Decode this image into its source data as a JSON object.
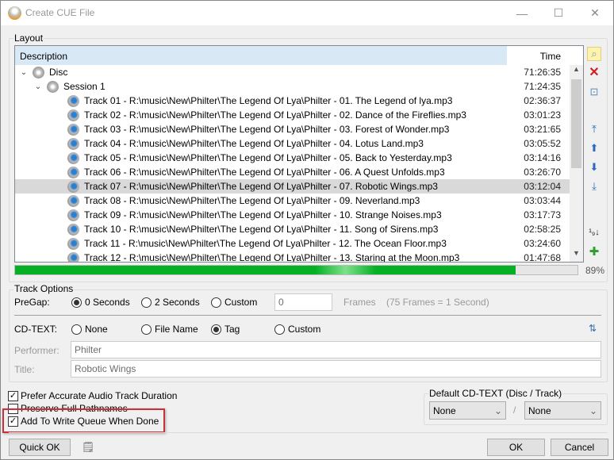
{
  "window": {
    "title": "Create CUE File",
    "controls": {
      "minimize": "—",
      "maximize": "☐",
      "close": "✕"
    }
  },
  "layout": {
    "label": "Layout",
    "columns": {
      "description": "Description",
      "time": "Time"
    },
    "rows": [
      {
        "level": 0,
        "type": "disc",
        "label": "Disc",
        "time": "71:26:35",
        "expanded": true
      },
      {
        "level": 1,
        "type": "session",
        "label": "Session 1",
        "time": "71:24:35",
        "expanded": true
      },
      {
        "level": 2,
        "type": "track",
        "label": "Track 01 - R:\\music\\New\\Philter\\The Legend Of Lya\\Philter - 01. The Legend of lya.mp3",
        "time": "02:36:37"
      },
      {
        "level": 2,
        "type": "track",
        "label": "Track 02 - R:\\music\\New\\Philter\\The Legend Of Lya\\Philter - 02. Dance of the Fireflies.mp3",
        "time": "03:01:23"
      },
      {
        "level": 2,
        "type": "track",
        "label": "Track 03 - R:\\music\\New\\Philter\\The Legend Of Lya\\Philter - 03. Forest of Wonder.mp3",
        "time": "03:21:65"
      },
      {
        "level": 2,
        "type": "track",
        "label": "Track 04 - R:\\music\\New\\Philter\\The Legend Of Lya\\Philter - 04. Lotus Land.mp3",
        "time": "03:05:52"
      },
      {
        "level": 2,
        "type": "track",
        "label": "Track 05 - R:\\music\\New\\Philter\\The Legend Of Lya\\Philter - 05. Back to Yesterday.mp3",
        "time": "03:14:16"
      },
      {
        "level": 2,
        "type": "track",
        "label": "Track 06 - R:\\music\\New\\Philter\\The Legend Of Lya\\Philter - 06. A Quest Unfolds.mp3",
        "time": "03:26:70"
      },
      {
        "level": 2,
        "type": "track",
        "label": "Track 07 - R:\\music\\New\\Philter\\The Legend Of Lya\\Philter - 07. Robotic Wings.mp3",
        "time": "03:12:04",
        "selected": true
      },
      {
        "level": 2,
        "type": "track",
        "label": "Track 08 - R:\\music\\New\\Philter\\The Legend Of Lya\\Philter - 09. Neverland.mp3",
        "time": "03:03:44"
      },
      {
        "level": 2,
        "type": "track",
        "label": "Track 09 - R:\\music\\New\\Philter\\The Legend Of Lya\\Philter - 10. Strange Noises.mp3",
        "time": "03:17:73"
      },
      {
        "level": 2,
        "type": "track",
        "label": "Track 10 - R:\\music\\New\\Philter\\The Legend Of Lya\\Philter - 11. Song of Sirens.mp3",
        "time": "02:58:25"
      },
      {
        "level": 2,
        "type": "track",
        "label": "Track 11 - R:\\music\\New\\Philter\\The Legend Of Lya\\Philter - 12. The Ocean Floor.mp3",
        "time": "03:24:60"
      },
      {
        "level": 2,
        "type": "track",
        "label": "Track 12 - R:\\music\\New\\Philter\\The Legend Of Lya\\Philter - 13. Staring at the Moon.mp3",
        "time": "01:47:68"
      }
    ],
    "side_buttons": [
      {
        "name": "browse-icon",
        "glyph": "🔍"
      },
      {
        "name": "delete-icon",
        "glyph": "✕"
      },
      {
        "name": "recycle-icon",
        "glyph": "🗑"
      },
      {
        "name": "move-top-icon",
        "glyph": "⤒"
      },
      {
        "name": "move-up-icon",
        "glyph": "🡅"
      },
      {
        "name": "move-down-icon",
        "glyph": "🡇"
      },
      {
        "name": "move-bottom-icon",
        "glyph": "⤓"
      },
      {
        "name": "sort-icon",
        "glyph": "¹₉↓"
      },
      {
        "name": "add-icon",
        "glyph": "✚"
      }
    ],
    "progress_percent": 89,
    "progress_label": "89%"
  },
  "track_options": {
    "label": "Track Options",
    "pregap": {
      "label": "PreGap:",
      "options": [
        "0 Seconds",
        "2 Seconds",
        "Custom"
      ],
      "selected": "0 Seconds",
      "frames_value": "0",
      "frames_label": "Frames",
      "frames_hint": "(75 Frames = 1 Second)"
    },
    "cdtext": {
      "label": "CD-TEXT:",
      "options": [
        "None",
        "File Name",
        "Tag",
        "Custom"
      ],
      "selected": "Tag"
    },
    "performer": {
      "label": "Performer:",
      "value": "Philter"
    },
    "title": {
      "label": "Title:",
      "value": "Robotic Wings"
    }
  },
  "checkboxes": [
    {
      "label": "Prefer Accurate Audio Track Duration",
      "checked": true
    },
    {
      "label": "Preserve Full Pathnames",
      "checked": false
    },
    {
      "label": "Add To Write Queue When Done",
      "checked": true
    }
  ],
  "default_cdtext": {
    "label": "Default CD-TEXT (Disc / Track)",
    "disc": "None",
    "separator": "/",
    "track": "None"
  },
  "buttons": {
    "quick_ok": "Quick OK",
    "ok": "OK",
    "cancel": "Cancel"
  }
}
